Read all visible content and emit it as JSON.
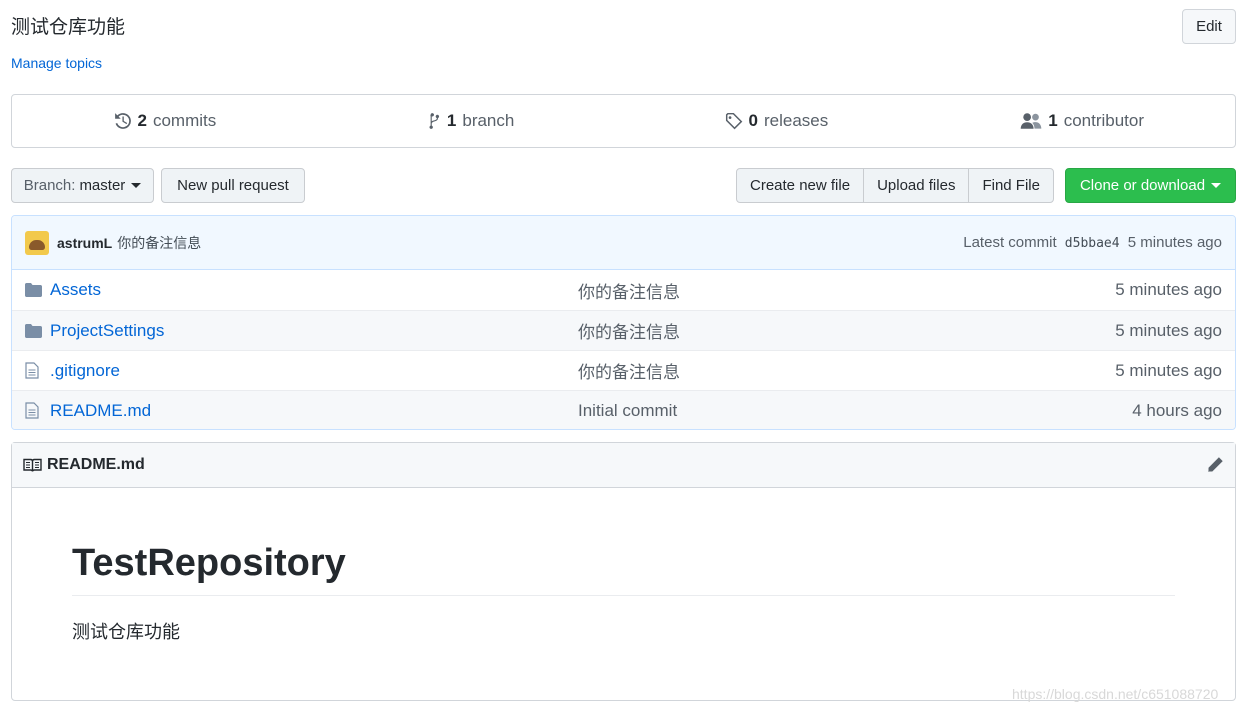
{
  "repo": {
    "description": "测试仓库功能",
    "manage_topics": "Manage topics",
    "edit_label": "Edit"
  },
  "summary": {
    "commits_num": "2",
    "commits_label": "commits",
    "branch_num": "1",
    "branch_label": "branch",
    "releases_num": "0",
    "releases_label": "releases",
    "contributor_num": "1",
    "contributor_label": "contributor"
  },
  "toolbar": {
    "branch_prefix": "Branch:",
    "branch_value": "master",
    "new_pr": "New pull request",
    "create_file": "Create new file",
    "upload_files": "Upload files",
    "find_file": "Find File",
    "clone": "Clone or download"
  },
  "commit": {
    "author": "astrumL",
    "message": "你的备注信息",
    "latest_prefix": "Latest commit",
    "sha": "d5bbae4",
    "time": "5 minutes ago"
  },
  "files": [
    {
      "type": "folder",
      "name": "Assets",
      "message": "你的备注信息",
      "age": "5 minutes ago",
      "icon": "folder-icon"
    },
    {
      "type": "folder",
      "name": "ProjectSettings",
      "message": "你的备注信息",
      "age": "5 minutes ago",
      "icon": "folder-icon"
    },
    {
      "type": "file",
      "name": ".gitignore",
      "message": "你的备注信息",
      "age": "5 minutes ago",
      "icon": "file-icon"
    },
    {
      "type": "file",
      "name": "README.md",
      "message": "Initial commit",
      "age": "4 hours ago",
      "icon": "file-icon"
    }
  ],
  "readme": {
    "filename": "README.md",
    "heading": "TestRepository",
    "body": "测试仓库功能"
  },
  "watermark": "https://blog.csdn.net/c651088720",
  "colors": {
    "link": "#0366d6",
    "clone_bg": "#2cbe4e",
    "commit_bar_bg": "#f1f8ff"
  }
}
